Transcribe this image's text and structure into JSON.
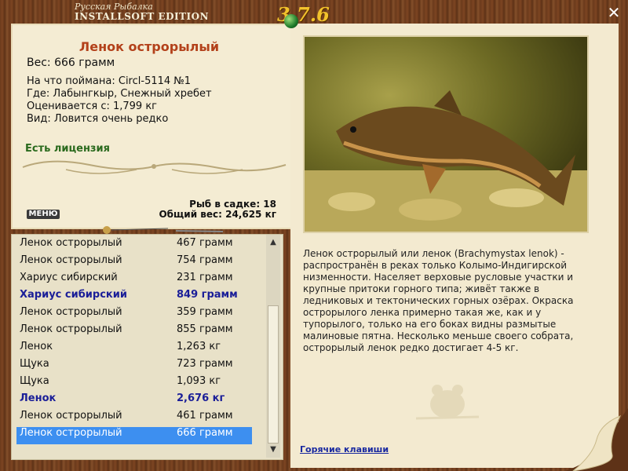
{
  "app": {
    "subtitle": "Русская Рыбалка",
    "edition": "INSTALLSOFT EDITION",
    "version": "3.7.6"
  },
  "catch": {
    "name": "Ленок острорылый",
    "weight_label": "Вес: 666 грамм",
    "caught_with": "На что поймана: Circl-5114 №1",
    "location": "Где: Лабынгкыр, Снежный хребет",
    "valued_from": "Оценивается с: 1,799 кг",
    "rarity": "Вид: Ловится очень редко",
    "license": "Есть лицензия"
  },
  "keepnet": {
    "count_label": "Рыб в садке: 18",
    "total_label": "Общий вес: 24,625 кг"
  },
  "menu_label": "МЕНЮ",
  "fish_list": [
    {
      "name": "Ленок острорылый",
      "weight": "467 грамм",
      "bold": false,
      "selected": false
    },
    {
      "name": "Ленок острорылый",
      "weight": "754 грамм",
      "bold": false,
      "selected": false
    },
    {
      "name": "Хариус сибирский",
      "weight": "231 грамм",
      "bold": false,
      "selected": false
    },
    {
      "name": "Хариус сибирский",
      "weight": "849 грамм",
      "bold": true,
      "selected": false
    },
    {
      "name": "Ленок острорылый",
      "weight": "359 грамм",
      "bold": false,
      "selected": false
    },
    {
      "name": "Ленок острорылый",
      "weight": "855 грамм",
      "bold": false,
      "selected": false
    },
    {
      "name": "Ленок",
      "weight": "1,263 кг",
      "bold": false,
      "selected": false
    },
    {
      "name": "Щука",
      "weight": "723 грамм",
      "bold": false,
      "selected": false
    },
    {
      "name": "Щука",
      "weight": "1,093 кг",
      "bold": false,
      "selected": false
    },
    {
      "name": "Ленок",
      "weight": "2,676 кг",
      "bold": true,
      "selected": false
    },
    {
      "name": "Ленок острорылый",
      "weight": "461 грамм",
      "bold": false,
      "selected": false
    },
    {
      "name": "Ленок острорылый",
      "weight": "666 грамм",
      "bold": false,
      "selected": true
    }
  ],
  "description": "Ленок острорылый или ленок (Brachymystax lenok) - распространён в реках только Колымо-Индигирской низменности. Населяет верховые русловые участки и крупные притоки горного типа; живёт также в ледниковых и тектонических горных озёрах. Окраска острорылого ленка примерно такая же, как и у тупорылого, только на его боках видны размытые малиновые пятна. Несколько меньше своего собрата, острорылый ленок редко достигает 4-5 кг.",
  "hotkeys_label": "Горячие клавиши",
  "icons": {
    "close": "close-icon",
    "scroll_up": "arrow-up-icon",
    "scroll_down": "arrow-down-icon",
    "pin": "pin-icon"
  },
  "colors": {
    "fish_name": "#b3411a",
    "license": "#2a6a1d",
    "bold_row": "#1a1e98",
    "selected_row": "#3d8ff0"
  }
}
